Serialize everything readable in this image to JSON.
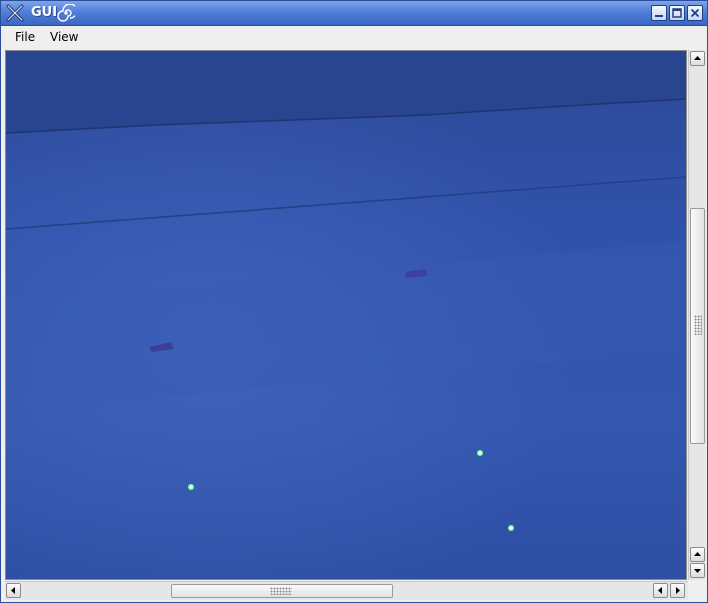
{
  "window": {
    "title": "GUI"
  },
  "menubar": {
    "items": [
      {
        "label": "File"
      },
      {
        "label": "View"
      }
    ]
  },
  "colors": {
    "titlebar": "#4f7fd9",
    "floor": "#2f4fa3",
    "marker": "#7dffb0"
  },
  "icons": {
    "app": "x-app-icon",
    "title_decoration": "swirl-icon",
    "minimize": "minimize-icon",
    "maximize": "maximize-icon",
    "close": "close-icon"
  }
}
